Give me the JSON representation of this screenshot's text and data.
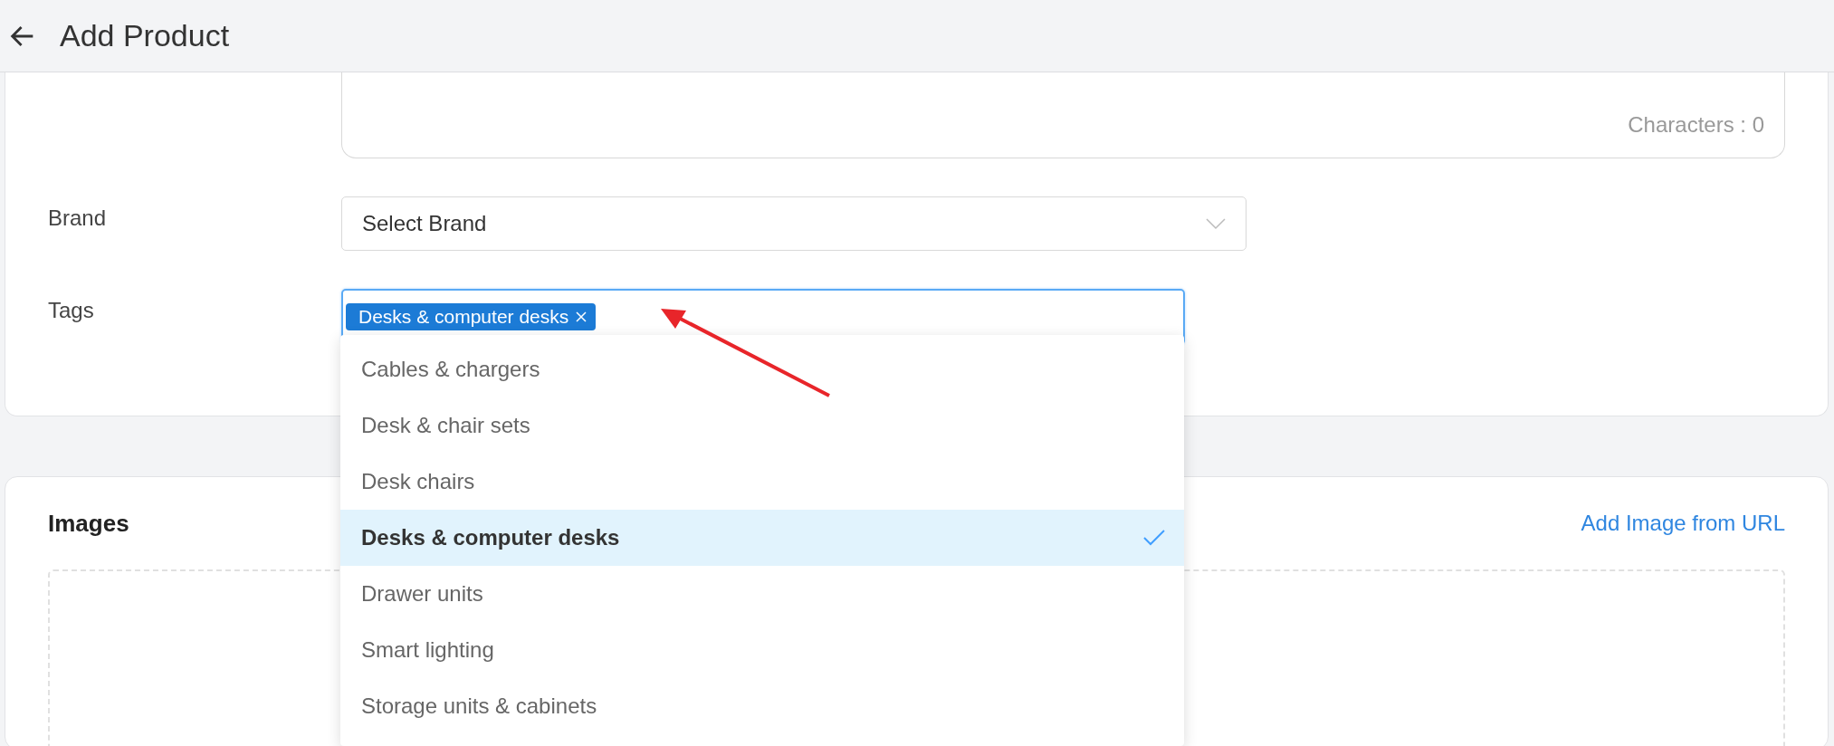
{
  "header": {
    "title": "Add Product"
  },
  "description": {
    "counter": "Characters : 0"
  },
  "fields": [
    {
      "kind": "select",
      "label": "Brand",
      "value": "Select Brand"
    },
    {
      "kind": "tags",
      "label": "Tags",
      "focused": true,
      "tags": [
        {
          "label": "Desks & computer desks"
        }
      ]
    }
  ],
  "tag_dropdown": {
    "options": [
      {
        "label": "Cables & chargers",
        "selected": false
      },
      {
        "label": "Desk & chair sets",
        "selected": false
      },
      {
        "label": "Desk chairs",
        "selected": false
      },
      {
        "label": "Desks & computer desks",
        "selected": true
      },
      {
        "label": "Drawer units",
        "selected": false
      },
      {
        "label": "Smart lighting",
        "selected": false
      },
      {
        "label": "Storage units & cabinets",
        "selected": false
      }
    ]
  },
  "images": {
    "title": "Images",
    "link": "Add Image from URL"
  }
}
